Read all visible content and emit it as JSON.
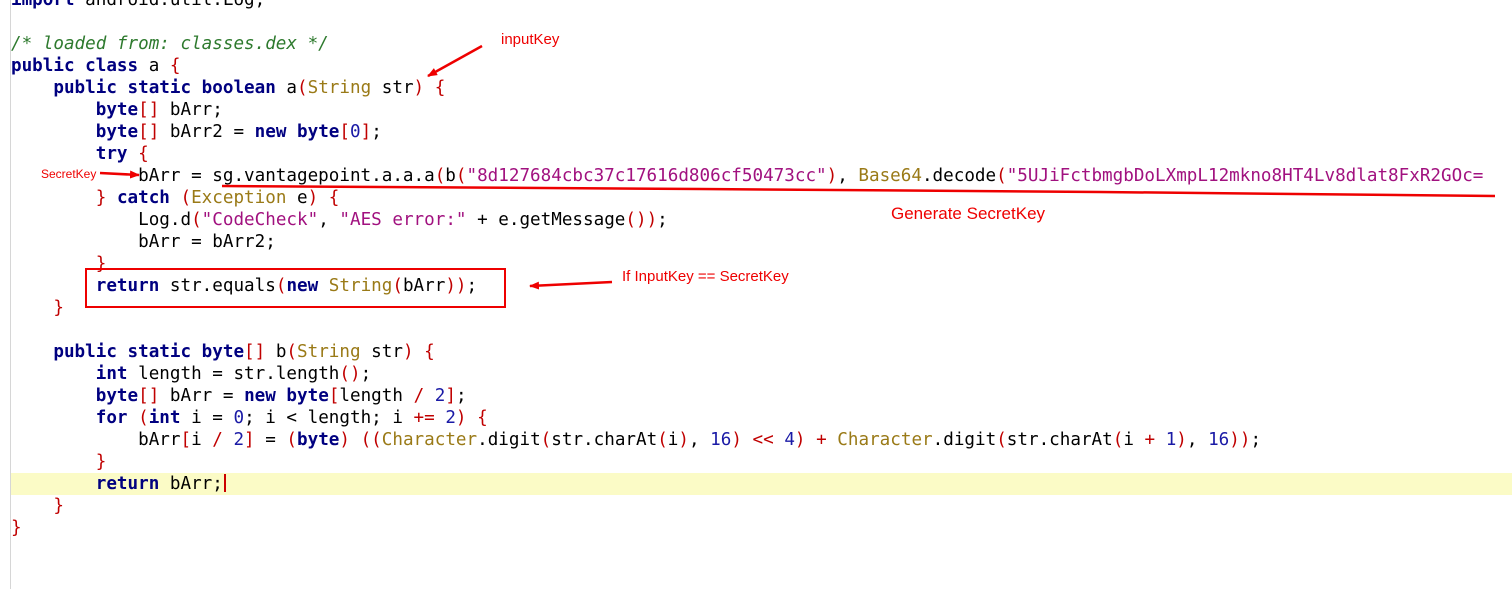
{
  "code": {
    "l0": {
      "kw": "import",
      "rest": " android.util.Log;"
    },
    "l1": {
      "comment": "/* loaded from: classes.dex */"
    },
    "l2": {
      "kw": "public class",
      "name": " a ",
      "brace": "{"
    },
    "l3": {
      "kw": "public static boolean",
      "name": " a",
      "p1": "(",
      "type": "String",
      "arg": " str",
      "p2": ")",
      "brace": " {"
    },
    "l4": {
      "kw": "byte",
      "p1": "[]",
      "rest": " bArr;"
    },
    "l5": {
      "kw": "byte",
      "p1": "[]",
      "rest": " bArr2 = ",
      "kw2": "new byte",
      "p2": "[",
      "num": "0",
      "p3": "]",
      "end": ";"
    },
    "l6": {
      "kw": "try",
      "brace": " {"
    },
    "l7": {
      "a": "bArr = sg.vantagepoint.a.a.a",
      "p1": "(",
      "b": "b",
      "p2": "(",
      "s1": "\"8d127684cbc37c17616d806cf50473cc\"",
      "p3": ")",
      "comma": ", ",
      "type": "Base64",
      "c": ".decode",
      "p4": "(",
      "s2": "\"5UJiFctbmgbDoLXmpL12mkno8HT4Lv8dlat8FxR2GOc="
    },
    "l8": {
      "brace": "} ",
      "kw": "catch",
      "p1": " (",
      "type": "Exception",
      "arg": " e",
      "p2": ")",
      "brace2": " {"
    },
    "l9": {
      "a": "Log.d",
      "p1": "(",
      "s1": "\"CodeCheck\"",
      "comma": ", ",
      "s2": "\"AES error:\"",
      "op": " + ",
      "b": "e.getMessage",
      "p2": "())",
      "end": ";"
    },
    "l10": {
      "rest": "bArr = bArr2;"
    },
    "l11": {
      "brace": "}"
    },
    "l12": {
      "kw": "return",
      "a": " str.equals",
      "p1": "(",
      "kw2": "new",
      "type": " String",
      "p2": "(",
      "b": "bArr",
      "p3": "))",
      "end": ";"
    },
    "l13": {
      "brace": "}"
    },
    "l15": {
      "kw": "public static byte",
      "p1": "[]",
      "name": " b",
      "p2": "(",
      "type": "String",
      "arg": " str",
      "p3": ")",
      "brace": " {"
    },
    "l16": {
      "kw": "int",
      "rest": " length = str.length",
      "p1": "()",
      "end": ";"
    },
    "l17": {
      "kw": "byte",
      "p1": "[]",
      "rest": " bArr = ",
      "kw2": "new byte",
      "p2": "[",
      "mid": "length ",
      "op": "/",
      "sp": " ",
      "num": "2",
      "p3": "]",
      "end": ";"
    },
    "l18": {
      "kw": "for",
      "p1": " (",
      "kw2": "int",
      "a": " i = ",
      "num1": "0",
      "b": "; i < length; i ",
      "op": "+=",
      "sp": " ",
      "num2": "2",
      "p2": ")",
      "brace": " {"
    },
    "l19": {
      "a": "bArr",
      "p1": "[",
      "b": "i ",
      "op1": "/",
      "sp1": " ",
      "num1": "2",
      "p2": "]",
      "c": " = ",
      "p3": "(",
      "kw": "byte",
      "p4": ")",
      "sp2": " ",
      "p5": "((",
      "type1": "Character",
      "d": ".digit",
      "p6": "(",
      "e": "str.charAt",
      "p7": "(",
      "f": "i",
      "p8": ")",
      "comma1": ", ",
      "num2": "16",
      "p9": ")",
      "op2": " << ",
      "num3": "4",
      "p10": ")",
      "op3": " + ",
      "type2": "Character",
      "g": ".digit",
      "p11": "(",
      "h": "str.charAt",
      "p12": "(",
      "i": "i ",
      "op4": "+",
      "sp3": " ",
      "num4": "1",
      "p13": ")",
      "comma2": ", ",
      "num5": "16",
      "p14": "))",
      "end": ";"
    },
    "l20": {
      "brace": "}"
    },
    "l21": {
      "kw": "return",
      "rest": " bArr;"
    },
    "l22": {
      "brace": "}"
    },
    "l23": {
      "brace": "}"
    }
  },
  "annotations": {
    "input_key": "inputKey",
    "secret_key": "SecretKey",
    "generate_secret_key": "Generate SecretKey",
    "compare": "If InputKey == SecretKey"
  },
  "colors": {
    "annotation": "#ee0000",
    "keyword": "#000080",
    "string": "#a1117f",
    "type": "#9a7a17",
    "comment": "#2e7a2e",
    "current_line": "#fbfbc6"
  }
}
